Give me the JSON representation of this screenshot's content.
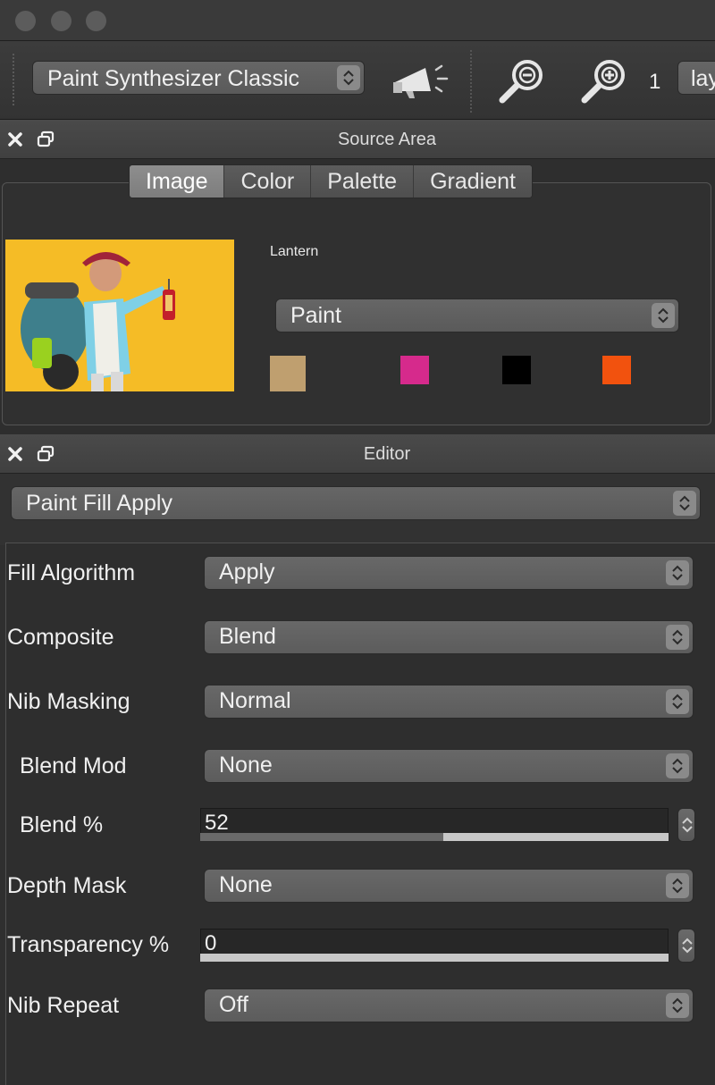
{
  "toolbar": {
    "preset": "Paint Synthesizer Classic",
    "zoom": "1",
    "layer": "layer"
  },
  "source": {
    "title": "Source Area",
    "tabs": [
      "Image",
      "Color",
      "Palette",
      "Gradient"
    ],
    "active_tab": "Image",
    "image_name": "Lantern",
    "mode": "Paint",
    "swatches": [
      "#bf9f6f",
      "#d62a8c",
      "#000000",
      "#f2520e"
    ]
  },
  "editor": {
    "title": "Editor",
    "effect": "Paint Fill Apply",
    "rows": {
      "fill_algorithm": {
        "label": "Fill Algorithm",
        "value": "Apply"
      },
      "composite": {
        "label": "Composite",
        "value": "Blend"
      },
      "nib_masking": {
        "label": "Nib Masking",
        "value": "Normal"
      },
      "blend_mod": {
        "label": "Blend Mod",
        "value": "None"
      },
      "blend_pct": {
        "label": "Blend %",
        "value": "52",
        "fraction": 0.52
      },
      "depth_mask": {
        "label": "Depth Mask",
        "value": "None"
      },
      "transparency_pct": {
        "label": "Transparency %",
        "value": "0",
        "fraction": 0.0
      },
      "nib_repeat": {
        "label": "Nib Repeat",
        "value": "Off"
      }
    }
  }
}
